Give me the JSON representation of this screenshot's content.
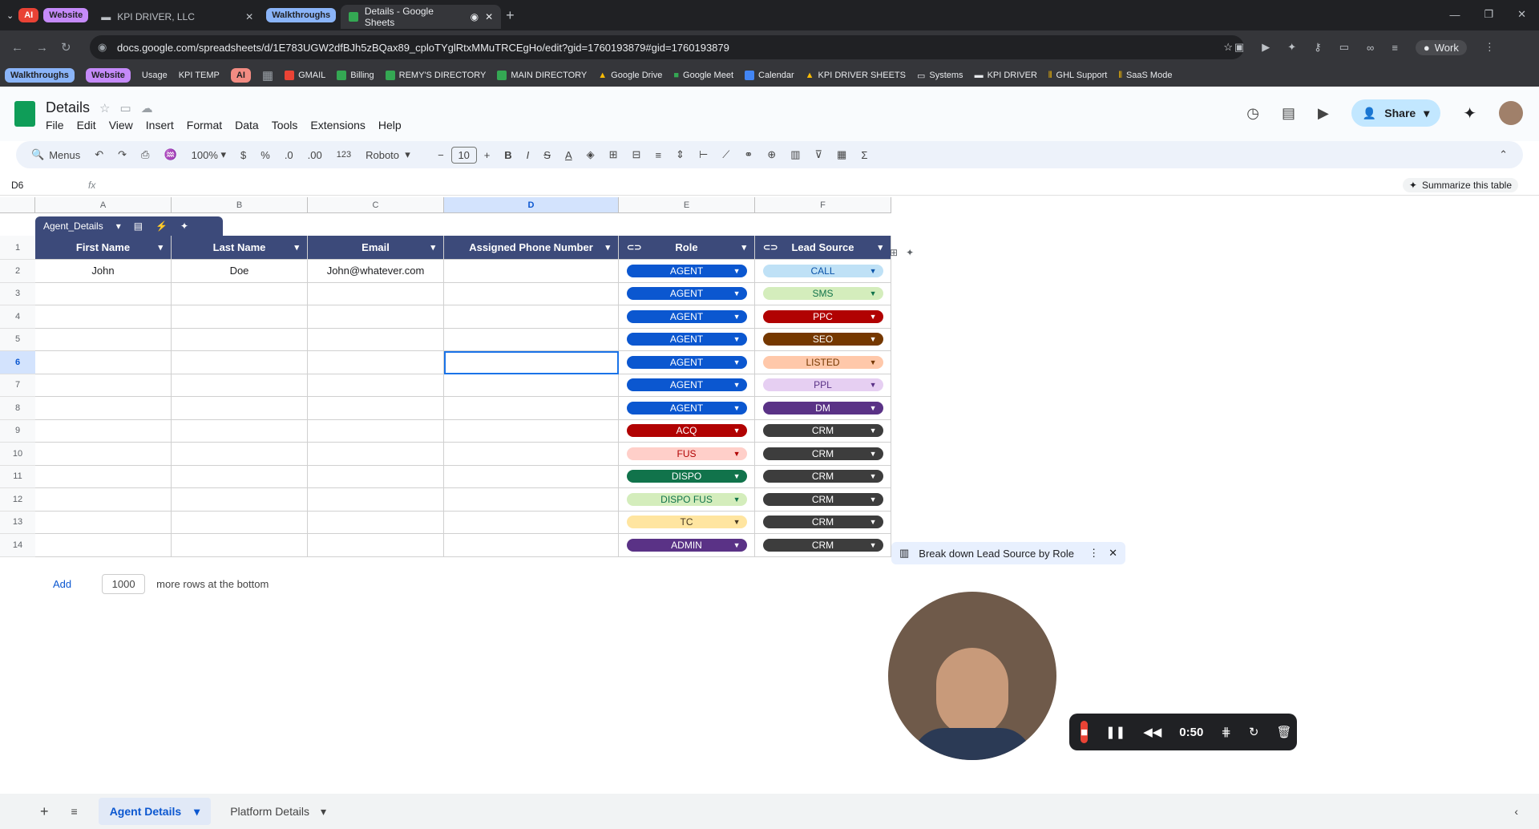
{
  "browser": {
    "tabs": [
      {
        "label": "KPI DRIVER, LLC"
      },
      {
        "label": "Details - Google Sheets"
      }
    ],
    "tab_groups": {
      "ai": "AI",
      "website": "Website",
      "walkthroughs": "Walkthroughs"
    },
    "url": "docs.google.com/spreadsheets/d/1E783UGW2dfBJh5zBQax89_cploTYglRtxMMuTRCEgHo/edit?gid=1760193879#gid=1760193879",
    "profile": "Work"
  },
  "bookmarks": [
    "Walkthroughs",
    "Website",
    "Usage",
    "KPI TEMP",
    "AI",
    "GMAIL",
    "Billing",
    "REMY'S DIRECTORY",
    "MAIN DIRECTORY",
    "Google Drive",
    "Google Meet",
    "Calendar",
    "KPI DRIVER SHEETS",
    "Systems",
    "KPI DRIVER",
    "GHL Support",
    "SaaS Mode"
  ],
  "doc": {
    "title": "Details",
    "menus": [
      "File",
      "Edit",
      "View",
      "Insert",
      "Format",
      "Data",
      "Tools",
      "Extensions",
      "Help"
    ],
    "share": "Share"
  },
  "toolbar": {
    "menus": "Menus",
    "zoom": "100%",
    "currency": "$",
    "percent": "%",
    "dec_minus": ".0",
    "dec_plus": ".00",
    "format_123": "123",
    "font": "Roboto",
    "font_size": "10"
  },
  "formula": {
    "cell_ref": "D6",
    "fx": "fx",
    "summarize": "Summarize this table"
  },
  "table": {
    "name": "Agent_Details"
  },
  "columns": [
    "A",
    "B",
    "C",
    "D",
    "E",
    "F"
  ],
  "headers": [
    "First Name",
    "Last Name",
    "Email",
    "Assigned Phone Number",
    "Role",
    "Lead Source"
  ],
  "rows": [
    {
      "n": "1"
    },
    {
      "n": "2",
      "first": "John",
      "last": "Doe",
      "email": "John@whatever.com",
      "role": "AGENT",
      "lead": "CALL"
    },
    {
      "n": "3",
      "role": "AGENT",
      "lead": "SMS"
    },
    {
      "n": "4",
      "role": "AGENT",
      "lead": "PPC"
    },
    {
      "n": "5",
      "role": "AGENT",
      "lead": "SEO"
    },
    {
      "n": "6",
      "role": "AGENT",
      "lead": "LISTED"
    },
    {
      "n": "7",
      "role": "AGENT",
      "lead": "PPL"
    },
    {
      "n": "8",
      "role": "AGENT",
      "lead": "DM"
    },
    {
      "n": "9",
      "role": "ACQ",
      "lead": "CRM"
    },
    {
      "n": "10",
      "role": "FUS",
      "lead": "CRM"
    },
    {
      "n": "11",
      "role": "DISPO",
      "lead": "CRM"
    },
    {
      "n": "12",
      "role": "DISPO FUS",
      "lead": "CRM"
    },
    {
      "n": "13",
      "role": "TC",
      "lead": "CRM"
    },
    {
      "n": "14",
      "role": "ADMIN",
      "lead": "CRM"
    }
  ],
  "role_colors": {
    "AGENT": [
      "#0b57d0",
      "#fff"
    ],
    "ACQ": [
      "#b10202",
      "#fff"
    ],
    "FUS": [
      "#ffcfc9",
      "#b10202"
    ],
    "DISPO": [
      "#11734b",
      "#fff"
    ],
    "DISPO FUS": [
      "#d4edbc",
      "#11734b"
    ],
    "TC": [
      "#ffe5a0",
      "#473821"
    ],
    "ADMIN": [
      "#5a3286",
      "#fff"
    ]
  },
  "lead_colors": {
    "CALL": [
      "#bfe1f6",
      "#0a53a8"
    ],
    "SMS": [
      "#d4edbc",
      "#11734b"
    ],
    "PPC": [
      "#b10202",
      "#fff"
    ],
    "SEO": [
      "#753800",
      "#fff"
    ],
    "LISTED": [
      "#ffc8aa",
      "#753800"
    ],
    "PPL": [
      "#e6cff2",
      "#5a3286"
    ],
    "DM": [
      "#5a3286",
      "#fff"
    ],
    "CRM": [
      "#3d3d3d",
      "#fff"
    ]
  },
  "add_rows": {
    "add": "Add",
    "count": "1000",
    "suffix": "more rows at the bottom"
  },
  "suggestion": "Break down Lead Source by Role",
  "recorder": {
    "time": "0:50"
  },
  "sheets": [
    "Agent Details",
    "Platform Details"
  ]
}
